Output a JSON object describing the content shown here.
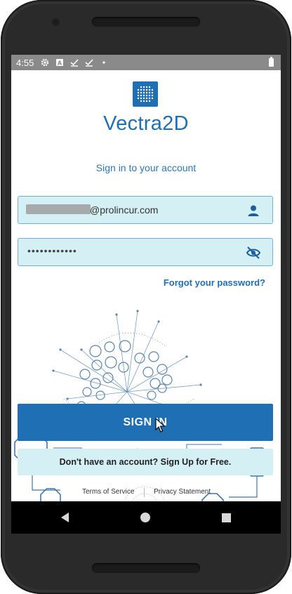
{
  "status_bar": {
    "time": "4:55",
    "icons": [
      "gear-icon",
      "a-badge-icon",
      "check-icon",
      "check-icon",
      "dot-icon",
      "battery-icon"
    ]
  },
  "app": {
    "title": "Vectra2D",
    "subtitle": "Sign in to your account",
    "brand_color": "#1e6fb3"
  },
  "email_field": {
    "value_visible": "@prolincur.com",
    "icon": "person-icon"
  },
  "password_field": {
    "value": "••••••••••••",
    "icon": "eye-off-icon"
  },
  "links": {
    "forgot_password": "Forgot your password?"
  },
  "buttons": {
    "sign_in": "SIGN IN",
    "sign_up": "Don't have an account? Sign Up for Free."
  },
  "footer": {
    "terms": "Terms of Service",
    "privacy": "Privacy Statement"
  },
  "colors": {
    "field_bg": "#d4f0f5",
    "accent": "#1e6fb3"
  }
}
